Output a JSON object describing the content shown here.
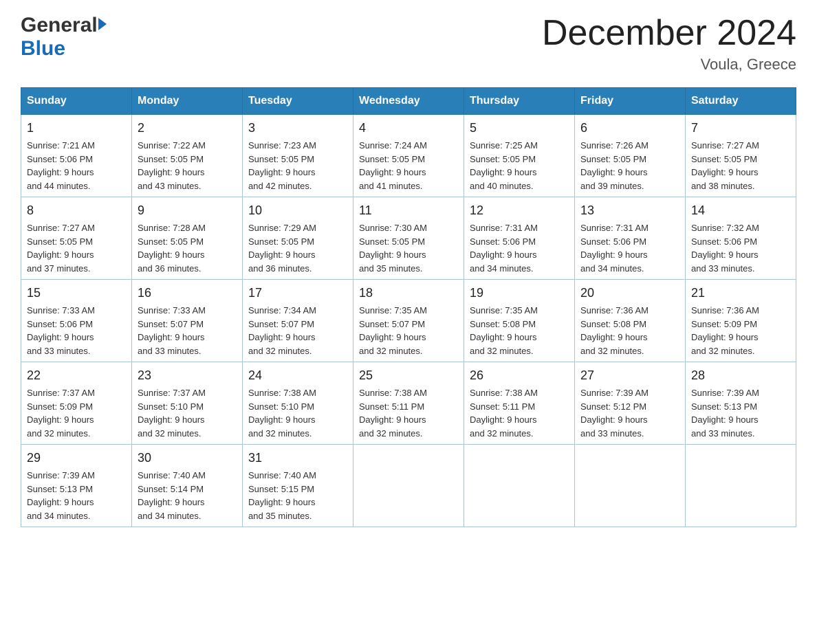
{
  "header": {
    "logo_general": "General",
    "logo_blue": "Blue",
    "main_title": "December 2024",
    "subtitle": "Voula, Greece"
  },
  "calendar": {
    "days_of_week": [
      "Sunday",
      "Monday",
      "Tuesday",
      "Wednesday",
      "Thursday",
      "Friday",
      "Saturday"
    ],
    "weeks": [
      [
        {
          "day": "1",
          "sunrise": "7:21 AM",
          "sunset": "5:06 PM",
          "daylight": "9 hours and 44 minutes."
        },
        {
          "day": "2",
          "sunrise": "7:22 AM",
          "sunset": "5:05 PM",
          "daylight": "9 hours and 43 minutes."
        },
        {
          "day": "3",
          "sunrise": "7:23 AM",
          "sunset": "5:05 PM",
          "daylight": "9 hours and 42 minutes."
        },
        {
          "day": "4",
          "sunrise": "7:24 AM",
          "sunset": "5:05 PM",
          "daylight": "9 hours and 41 minutes."
        },
        {
          "day": "5",
          "sunrise": "7:25 AM",
          "sunset": "5:05 PM",
          "daylight": "9 hours and 40 minutes."
        },
        {
          "day": "6",
          "sunrise": "7:26 AM",
          "sunset": "5:05 PM",
          "daylight": "9 hours and 39 minutes."
        },
        {
          "day": "7",
          "sunrise": "7:27 AM",
          "sunset": "5:05 PM",
          "daylight": "9 hours and 38 minutes."
        }
      ],
      [
        {
          "day": "8",
          "sunrise": "7:27 AM",
          "sunset": "5:05 PM",
          "daylight": "9 hours and 37 minutes."
        },
        {
          "day": "9",
          "sunrise": "7:28 AM",
          "sunset": "5:05 PM",
          "daylight": "9 hours and 36 minutes."
        },
        {
          "day": "10",
          "sunrise": "7:29 AM",
          "sunset": "5:05 PM",
          "daylight": "9 hours and 36 minutes."
        },
        {
          "day": "11",
          "sunrise": "7:30 AM",
          "sunset": "5:05 PM",
          "daylight": "9 hours and 35 minutes."
        },
        {
          "day": "12",
          "sunrise": "7:31 AM",
          "sunset": "5:06 PM",
          "daylight": "9 hours and 34 minutes."
        },
        {
          "day": "13",
          "sunrise": "7:31 AM",
          "sunset": "5:06 PM",
          "daylight": "9 hours and 34 minutes."
        },
        {
          "day": "14",
          "sunrise": "7:32 AM",
          "sunset": "5:06 PM",
          "daylight": "9 hours and 33 minutes."
        }
      ],
      [
        {
          "day": "15",
          "sunrise": "7:33 AM",
          "sunset": "5:06 PM",
          "daylight": "9 hours and 33 minutes."
        },
        {
          "day": "16",
          "sunrise": "7:33 AM",
          "sunset": "5:07 PM",
          "daylight": "9 hours and 33 minutes."
        },
        {
          "day": "17",
          "sunrise": "7:34 AM",
          "sunset": "5:07 PM",
          "daylight": "9 hours and 32 minutes."
        },
        {
          "day": "18",
          "sunrise": "7:35 AM",
          "sunset": "5:07 PM",
          "daylight": "9 hours and 32 minutes."
        },
        {
          "day": "19",
          "sunrise": "7:35 AM",
          "sunset": "5:08 PM",
          "daylight": "9 hours and 32 minutes."
        },
        {
          "day": "20",
          "sunrise": "7:36 AM",
          "sunset": "5:08 PM",
          "daylight": "9 hours and 32 minutes."
        },
        {
          "day": "21",
          "sunrise": "7:36 AM",
          "sunset": "5:09 PM",
          "daylight": "9 hours and 32 minutes."
        }
      ],
      [
        {
          "day": "22",
          "sunrise": "7:37 AM",
          "sunset": "5:09 PM",
          "daylight": "9 hours and 32 minutes."
        },
        {
          "day": "23",
          "sunrise": "7:37 AM",
          "sunset": "5:10 PM",
          "daylight": "9 hours and 32 minutes."
        },
        {
          "day": "24",
          "sunrise": "7:38 AM",
          "sunset": "5:10 PM",
          "daylight": "9 hours and 32 minutes."
        },
        {
          "day": "25",
          "sunrise": "7:38 AM",
          "sunset": "5:11 PM",
          "daylight": "9 hours and 32 minutes."
        },
        {
          "day": "26",
          "sunrise": "7:38 AM",
          "sunset": "5:11 PM",
          "daylight": "9 hours and 32 minutes."
        },
        {
          "day": "27",
          "sunrise": "7:39 AM",
          "sunset": "5:12 PM",
          "daylight": "9 hours and 33 minutes."
        },
        {
          "day": "28",
          "sunrise": "7:39 AM",
          "sunset": "5:13 PM",
          "daylight": "9 hours and 33 minutes."
        }
      ],
      [
        {
          "day": "29",
          "sunrise": "7:39 AM",
          "sunset": "5:13 PM",
          "daylight": "9 hours and 34 minutes."
        },
        {
          "day": "30",
          "sunrise": "7:40 AM",
          "sunset": "5:14 PM",
          "daylight": "9 hours and 34 minutes."
        },
        {
          "day": "31",
          "sunrise": "7:40 AM",
          "sunset": "5:15 PM",
          "daylight": "9 hours and 35 minutes."
        },
        null,
        null,
        null,
        null
      ]
    ],
    "labels": {
      "sunrise": "Sunrise:",
      "sunset": "Sunset:",
      "daylight": "Daylight:"
    }
  }
}
